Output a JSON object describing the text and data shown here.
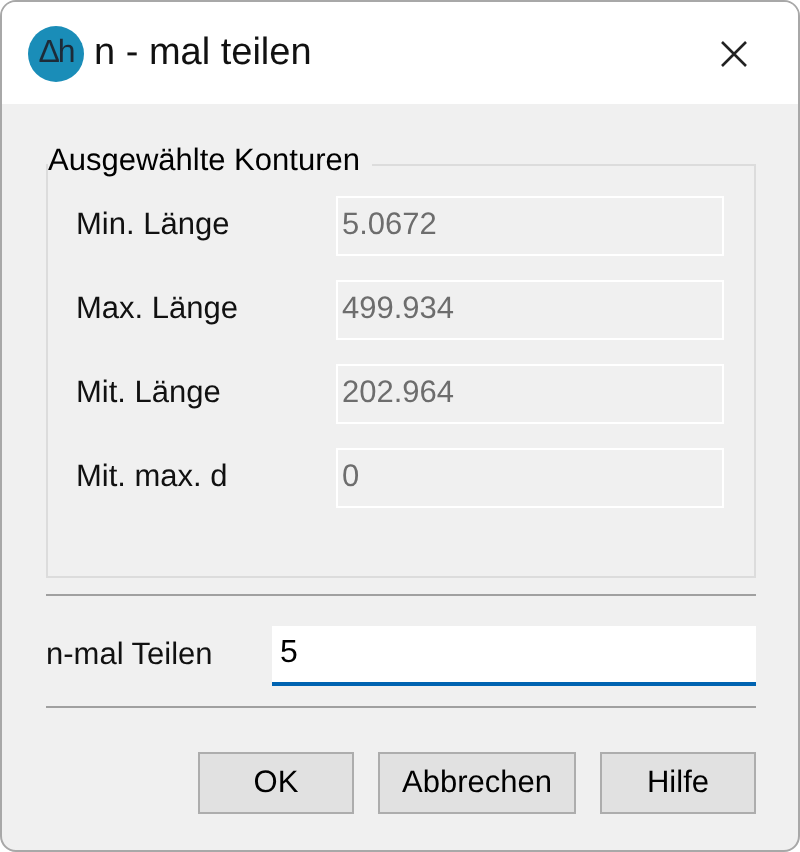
{
  "window": {
    "logo": "Δh",
    "title": "n - mal teilen"
  },
  "group": {
    "title": "Ausgewählte Konturen",
    "fields": [
      {
        "label": "Min. Länge",
        "value": "5.0672",
        "disabled": true
      },
      {
        "label": "Max. Länge",
        "value": "499.934",
        "disabled": true
      },
      {
        "label": "Mit. Länge",
        "value": "202.964",
        "disabled": true
      },
      {
        "label": "Mit. max. d",
        "value": "0",
        "disabled": true
      }
    ]
  },
  "input": {
    "label": "n-mal Teilen",
    "value": "5",
    "focused": true
  },
  "buttons": [
    "OK",
    "Abbrechen",
    "Hilfe"
  ]
}
